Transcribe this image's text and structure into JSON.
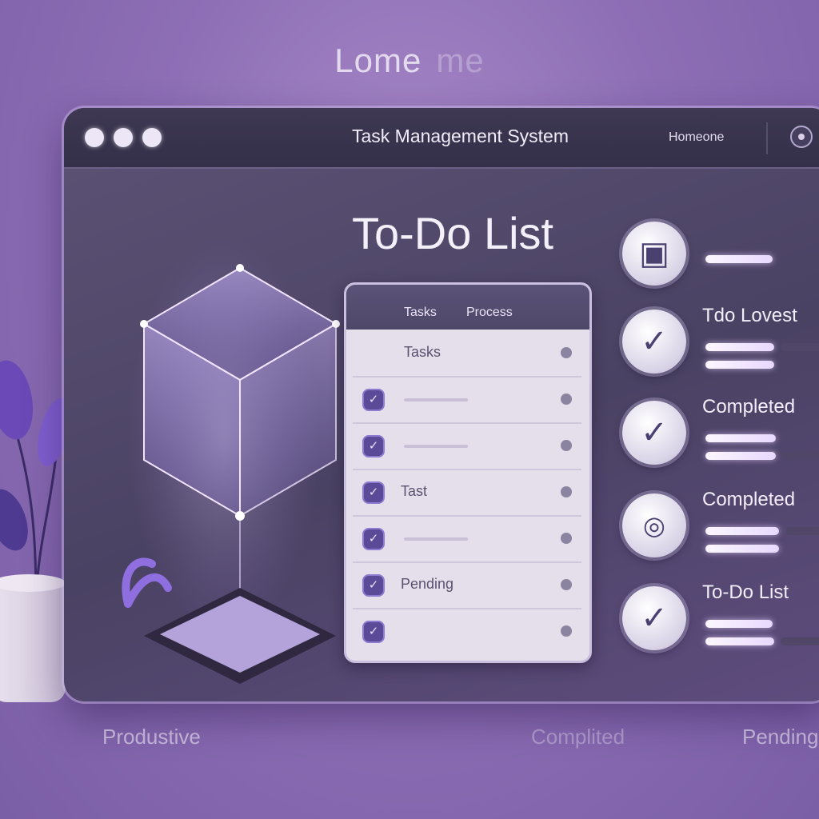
{
  "background": {
    "heading": "Lome",
    "heading_ghost": "me"
  },
  "window": {
    "title": "Task Management System",
    "nav_link": "Homeone",
    "controls": [
      "window-dot-1",
      "window-dot-2",
      "window-dot-3"
    ]
  },
  "main": {
    "heading": "To-Do List",
    "notepad": {
      "tabs": [
        "Tasks",
        "Process"
      ],
      "rows": [
        {
          "label": "Tasks",
          "checked": false
        },
        {
          "label": "",
          "checked": true
        },
        {
          "label": "",
          "checked": true
        },
        {
          "label": "Tast",
          "checked": true
        },
        {
          "label": "",
          "checked": true
        },
        {
          "label": "Pending",
          "checked": true
        },
        {
          "label": "",
          "checked": true
        },
        {
          "label": "",
          "checked": false
        }
      ]
    },
    "status_list": [
      {
        "label": "",
        "icon": "chat-icon"
      },
      {
        "label": "Tdo Lovest",
        "icon": "check-icon"
      },
      {
        "label": "Completed",
        "icon": "check-icon"
      },
      {
        "label": "Completed",
        "icon": "message-icon"
      },
      {
        "label": "To-Do List",
        "icon": "check-icon"
      }
    ]
  },
  "footer": {
    "left": "Produstive",
    "center": "Complited",
    "right": "Pending"
  },
  "colors": {
    "accent": "#5a4a98",
    "window_bg": "#4a4263",
    "page_bg": "#8e6fb6"
  }
}
